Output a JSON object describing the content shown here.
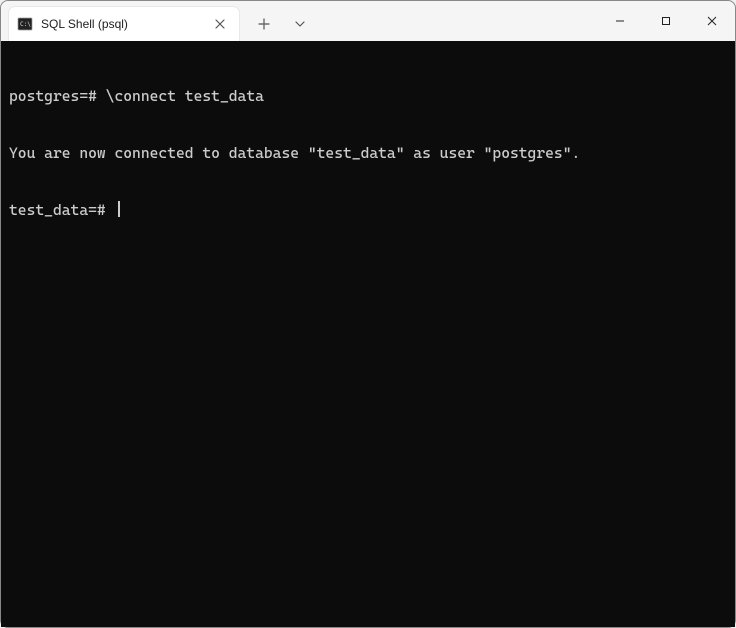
{
  "window": {
    "tab_title": "SQL Shell (psql)"
  },
  "terminal": {
    "line1_prompt": "postgres=#",
    "line1_cmd": "\\connect test_data",
    "line2": "You are now connected to database \"test_data\" as user \"postgres\".",
    "line3_prompt": "test_data=#"
  }
}
